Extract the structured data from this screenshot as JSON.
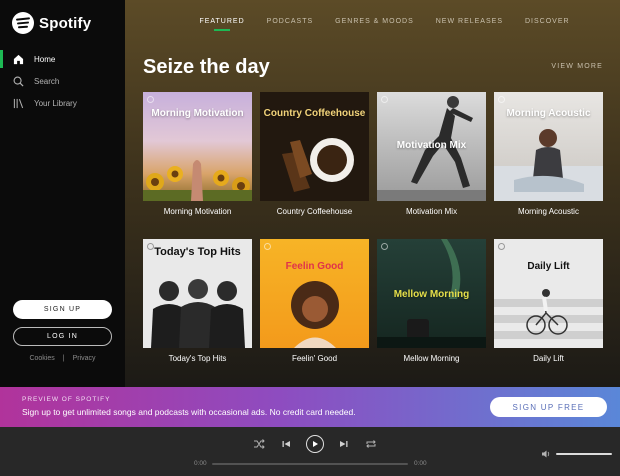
{
  "app": {
    "logo_text": "Spotify"
  },
  "sidebar": {
    "items": [
      {
        "label": "Home",
        "icon": "home-icon"
      },
      {
        "label": "Search",
        "icon": "search-icon"
      },
      {
        "label": "Your Library",
        "icon": "library-icon"
      }
    ],
    "signup_label": "SIGN UP",
    "login_label": "LOG IN",
    "cookies_label": "Cookies",
    "privacy_label": "Privacy",
    "legal_separator": "|"
  },
  "tabs": [
    "FEATURED",
    "PODCASTS",
    "GENRES & MOODS",
    "NEW RELEASES",
    "DISCOVER"
  ],
  "main": {
    "section_title": "Seize the day",
    "view_more_label": "VIEW MORE"
  },
  "playlists": [
    {
      "title": "Morning Motivation",
      "cover_text": "Morning Motivation"
    },
    {
      "title": "Country Coffeehouse",
      "cover_text": "Country Coffeehouse"
    },
    {
      "title": "Motivation Mix",
      "cover_text": "Motivation Mix"
    },
    {
      "title": "Morning Acoustic",
      "cover_text": "Morning Acoustic"
    },
    {
      "title": "Today's Top Hits",
      "cover_text": "Today's Top Hits"
    },
    {
      "title": "Feelin' Good",
      "cover_text": "Feelin Good"
    },
    {
      "title": "Mellow Morning",
      "cover_text": "Mellow Morning"
    },
    {
      "title": "Daily Lift",
      "cover_text": "Daily Lift"
    }
  ],
  "banner": {
    "small_label": "PREVIEW OF SPOTIFY",
    "message": "Sign up to get unlimited songs and podcasts with occasional ads. No credit card needed.",
    "cta_label": "SIGN UP FREE"
  },
  "player": {
    "time_elapsed": "0:00",
    "time_total": "0:00"
  },
  "colors": {
    "accent": "#1db954",
    "sidebar_bg": "#0b0b0b",
    "player_bg": "#282828"
  }
}
